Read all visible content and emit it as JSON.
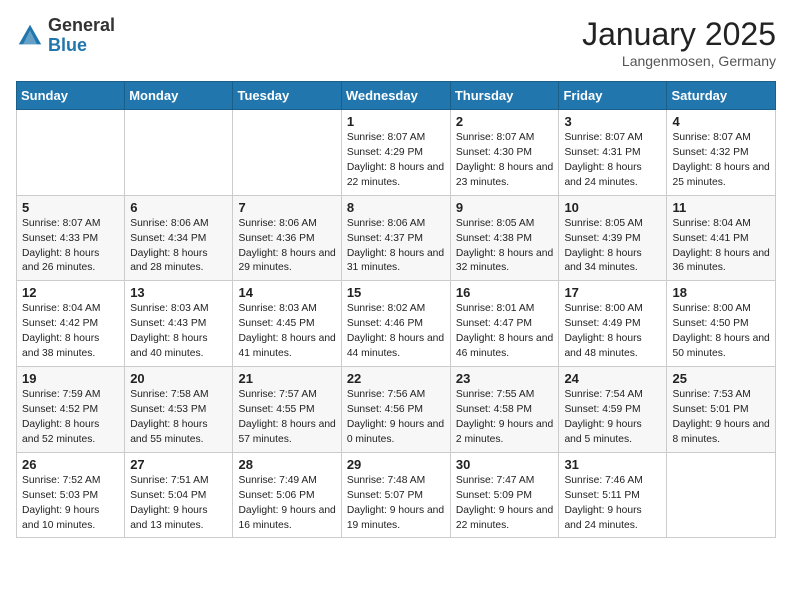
{
  "header": {
    "logo_general": "General",
    "logo_blue": "Blue",
    "month": "January 2025",
    "location": "Langenmosen, Germany"
  },
  "weekdays": [
    "Sunday",
    "Monday",
    "Tuesday",
    "Wednesday",
    "Thursday",
    "Friday",
    "Saturday"
  ],
  "weeks": [
    [
      {
        "day": "",
        "detail": ""
      },
      {
        "day": "",
        "detail": ""
      },
      {
        "day": "",
        "detail": ""
      },
      {
        "day": "1",
        "detail": "Sunrise: 8:07 AM\nSunset: 4:29 PM\nDaylight: 8 hours and 22 minutes."
      },
      {
        "day": "2",
        "detail": "Sunrise: 8:07 AM\nSunset: 4:30 PM\nDaylight: 8 hours and 23 minutes."
      },
      {
        "day": "3",
        "detail": "Sunrise: 8:07 AM\nSunset: 4:31 PM\nDaylight: 8 hours and 24 minutes."
      },
      {
        "day": "4",
        "detail": "Sunrise: 8:07 AM\nSunset: 4:32 PM\nDaylight: 8 hours and 25 minutes."
      }
    ],
    [
      {
        "day": "5",
        "detail": "Sunrise: 8:07 AM\nSunset: 4:33 PM\nDaylight: 8 hours and 26 minutes."
      },
      {
        "day": "6",
        "detail": "Sunrise: 8:06 AM\nSunset: 4:34 PM\nDaylight: 8 hours and 28 minutes."
      },
      {
        "day": "7",
        "detail": "Sunrise: 8:06 AM\nSunset: 4:36 PM\nDaylight: 8 hours and 29 minutes."
      },
      {
        "day": "8",
        "detail": "Sunrise: 8:06 AM\nSunset: 4:37 PM\nDaylight: 8 hours and 31 minutes."
      },
      {
        "day": "9",
        "detail": "Sunrise: 8:05 AM\nSunset: 4:38 PM\nDaylight: 8 hours and 32 minutes."
      },
      {
        "day": "10",
        "detail": "Sunrise: 8:05 AM\nSunset: 4:39 PM\nDaylight: 8 hours and 34 minutes."
      },
      {
        "day": "11",
        "detail": "Sunrise: 8:04 AM\nSunset: 4:41 PM\nDaylight: 8 hours and 36 minutes."
      }
    ],
    [
      {
        "day": "12",
        "detail": "Sunrise: 8:04 AM\nSunset: 4:42 PM\nDaylight: 8 hours and 38 minutes."
      },
      {
        "day": "13",
        "detail": "Sunrise: 8:03 AM\nSunset: 4:43 PM\nDaylight: 8 hours and 40 minutes."
      },
      {
        "day": "14",
        "detail": "Sunrise: 8:03 AM\nSunset: 4:45 PM\nDaylight: 8 hours and 41 minutes."
      },
      {
        "day": "15",
        "detail": "Sunrise: 8:02 AM\nSunset: 4:46 PM\nDaylight: 8 hours and 44 minutes."
      },
      {
        "day": "16",
        "detail": "Sunrise: 8:01 AM\nSunset: 4:47 PM\nDaylight: 8 hours and 46 minutes."
      },
      {
        "day": "17",
        "detail": "Sunrise: 8:00 AM\nSunset: 4:49 PM\nDaylight: 8 hours and 48 minutes."
      },
      {
        "day": "18",
        "detail": "Sunrise: 8:00 AM\nSunset: 4:50 PM\nDaylight: 8 hours and 50 minutes."
      }
    ],
    [
      {
        "day": "19",
        "detail": "Sunrise: 7:59 AM\nSunset: 4:52 PM\nDaylight: 8 hours and 52 minutes."
      },
      {
        "day": "20",
        "detail": "Sunrise: 7:58 AM\nSunset: 4:53 PM\nDaylight: 8 hours and 55 minutes."
      },
      {
        "day": "21",
        "detail": "Sunrise: 7:57 AM\nSunset: 4:55 PM\nDaylight: 8 hours and 57 minutes."
      },
      {
        "day": "22",
        "detail": "Sunrise: 7:56 AM\nSunset: 4:56 PM\nDaylight: 9 hours and 0 minutes."
      },
      {
        "day": "23",
        "detail": "Sunrise: 7:55 AM\nSunset: 4:58 PM\nDaylight: 9 hours and 2 minutes."
      },
      {
        "day": "24",
        "detail": "Sunrise: 7:54 AM\nSunset: 4:59 PM\nDaylight: 9 hours and 5 minutes."
      },
      {
        "day": "25",
        "detail": "Sunrise: 7:53 AM\nSunset: 5:01 PM\nDaylight: 9 hours and 8 minutes."
      }
    ],
    [
      {
        "day": "26",
        "detail": "Sunrise: 7:52 AM\nSunset: 5:03 PM\nDaylight: 9 hours and 10 minutes."
      },
      {
        "day": "27",
        "detail": "Sunrise: 7:51 AM\nSunset: 5:04 PM\nDaylight: 9 hours and 13 minutes."
      },
      {
        "day": "28",
        "detail": "Sunrise: 7:49 AM\nSunset: 5:06 PM\nDaylight: 9 hours and 16 minutes."
      },
      {
        "day": "29",
        "detail": "Sunrise: 7:48 AM\nSunset: 5:07 PM\nDaylight: 9 hours and 19 minutes."
      },
      {
        "day": "30",
        "detail": "Sunrise: 7:47 AM\nSunset: 5:09 PM\nDaylight: 9 hours and 22 minutes."
      },
      {
        "day": "31",
        "detail": "Sunrise: 7:46 AM\nSunset: 5:11 PM\nDaylight: 9 hours and 24 minutes."
      },
      {
        "day": "",
        "detail": ""
      }
    ]
  ]
}
